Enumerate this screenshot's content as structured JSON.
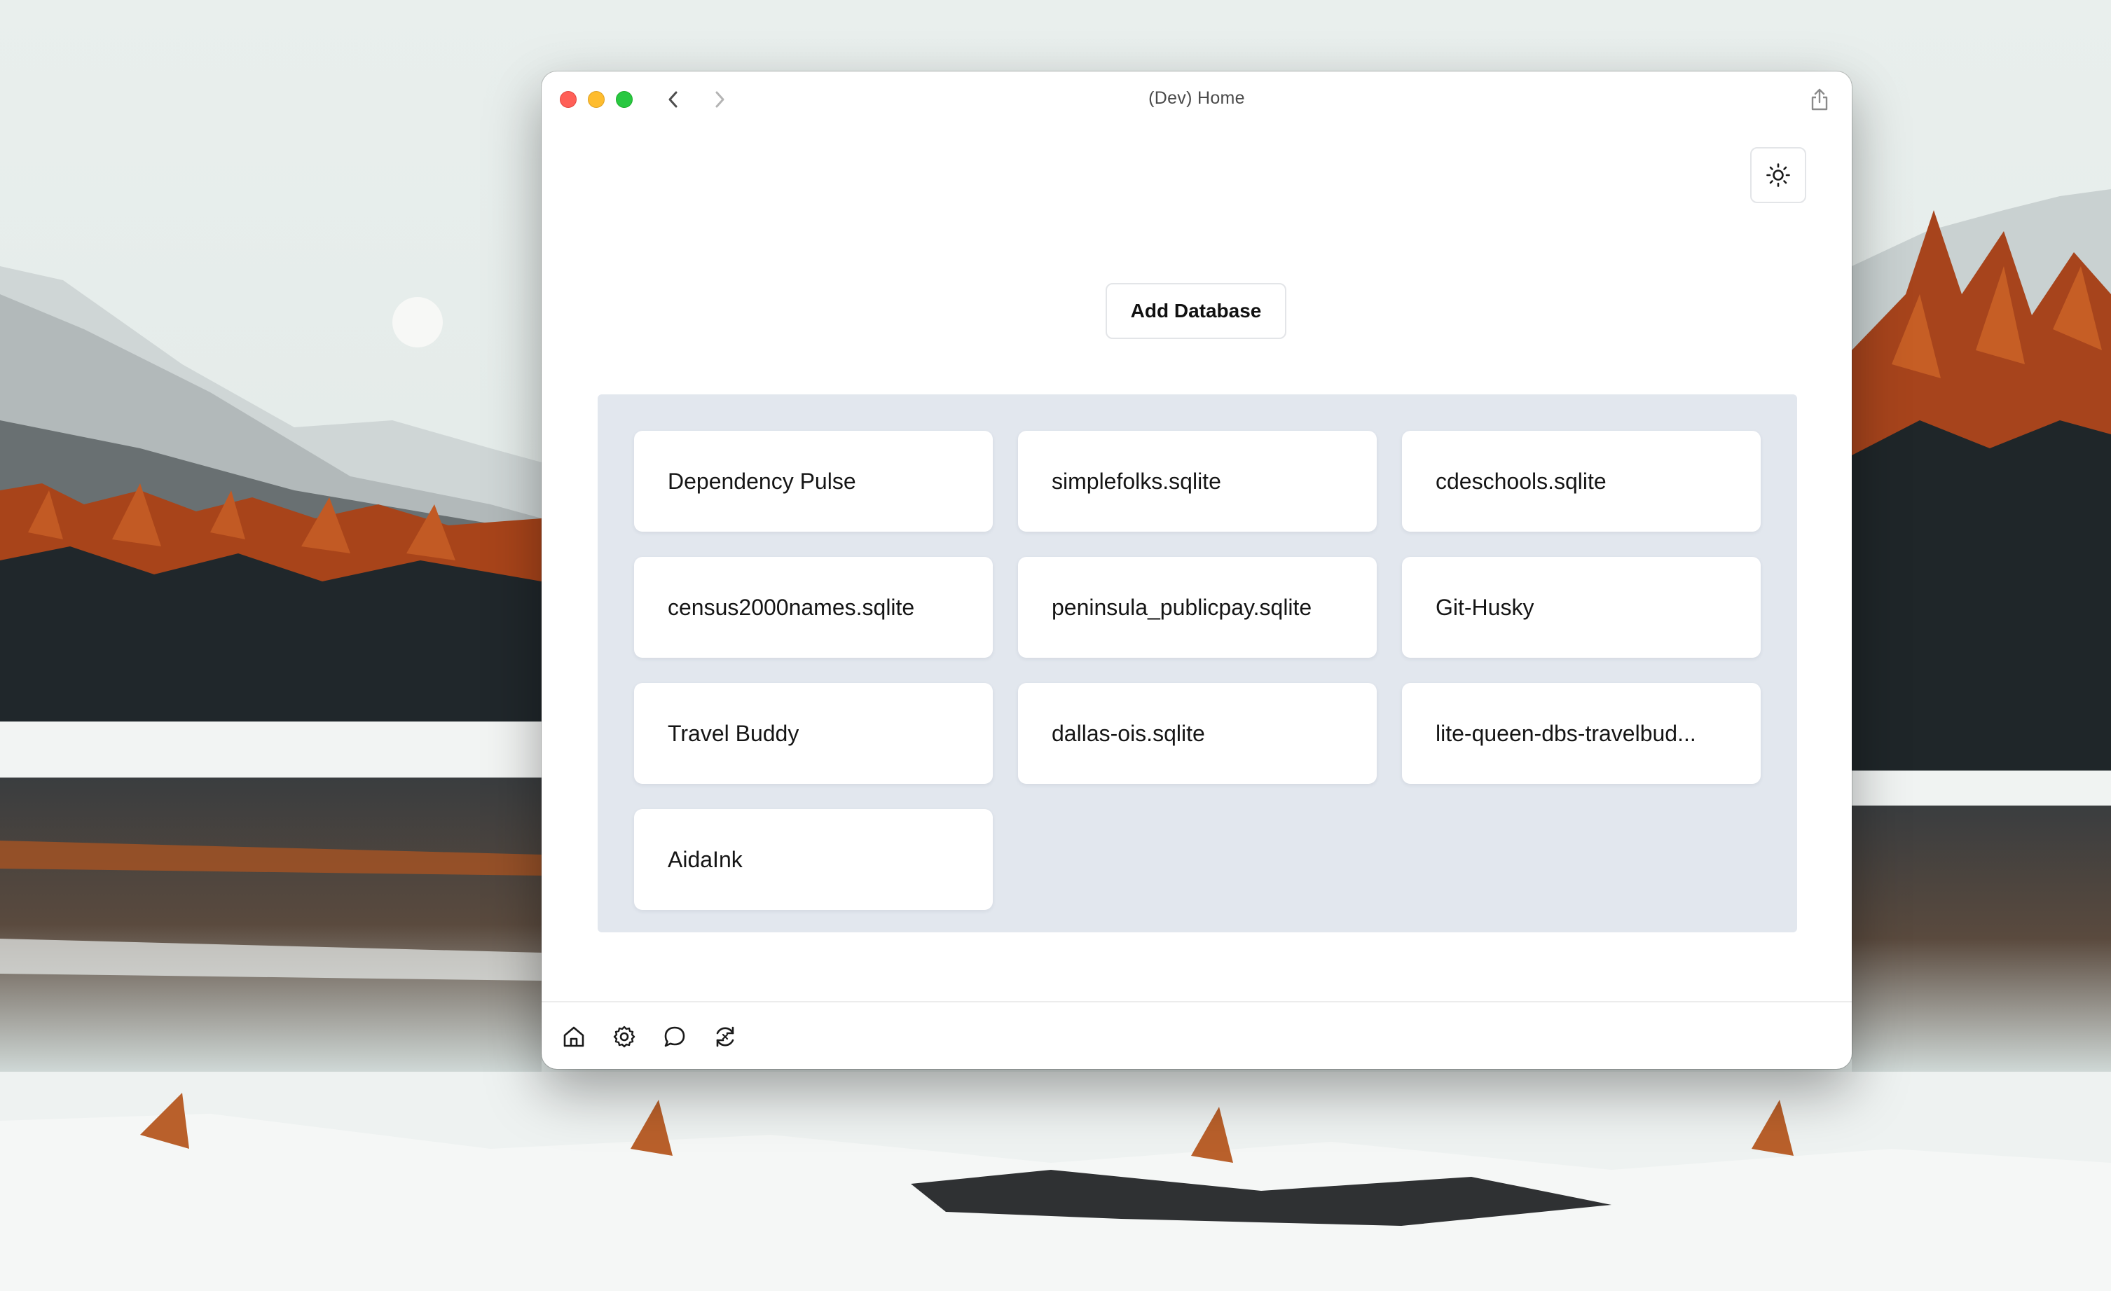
{
  "window": {
    "title": "(Dev) Home"
  },
  "toolbar": {
    "theme_icon": "sun-icon",
    "add_database_label": "Add Database"
  },
  "databases": [
    {
      "label": "Dependency Pulse"
    },
    {
      "label": "simplefolks.sqlite"
    },
    {
      "label": "cdeschools.sqlite"
    },
    {
      "label": "census2000names.sqlite"
    },
    {
      "label": "peninsula_publicpay.sqlite"
    },
    {
      "label": "Git-Husky"
    },
    {
      "label": "Travel Buddy"
    },
    {
      "label": "dallas-ois.sqlite"
    },
    {
      "label": "lite-queen-dbs-travelbud..."
    },
    {
      "label": "AidaInk"
    }
  ],
  "bottom_nav": {
    "icons": [
      "home-icon",
      "gear-icon",
      "chat-icon",
      "refresh-icon"
    ]
  },
  "colors": {
    "close": "#ff5f57",
    "minimize": "#febc2e",
    "maximize": "#28c840",
    "panel_bg": "#e2e7ee",
    "card_bg": "#ffffff"
  }
}
